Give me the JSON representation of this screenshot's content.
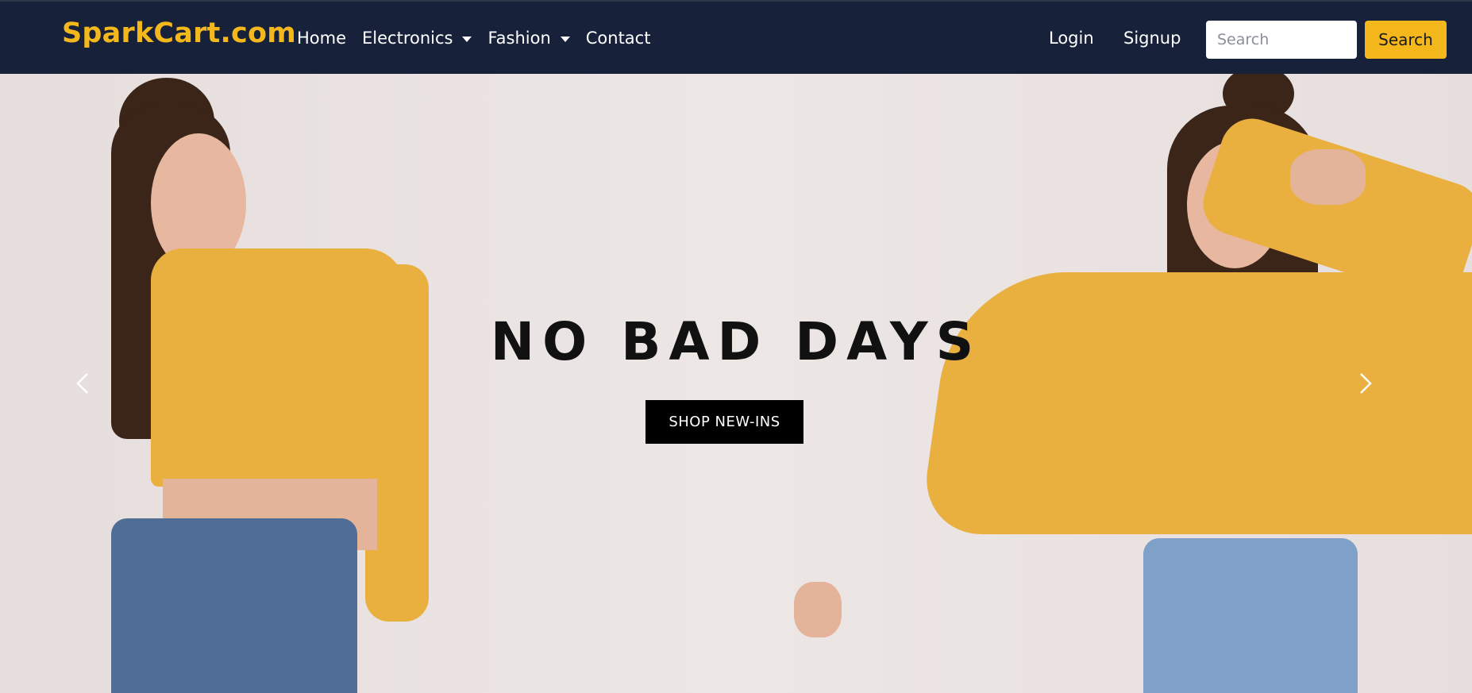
{
  "navbar": {
    "brand": "SparkCart.com",
    "links": [
      {
        "label": "Home",
        "dropdown": false
      },
      {
        "label": "Electronics",
        "dropdown": true
      },
      {
        "label": "Fashion",
        "dropdown": true
      },
      {
        "label": "Contact",
        "dropdown": false
      }
    ],
    "login": "Login",
    "signup": "Signup",
    "search_placeholder": "Search",
    "search_button": "Search"
  },
  "hero": {
    "headline": "NO BAD DAYS",
    "cta": "SHOP NEW-INS",
    "prev_icon": "chevron-left-icon",
    "next_icon": "chevron-right-icon"
  },
  "colors": {
    "navbar_bg": "#17223a",
    "accent": "#f5b81c",
    "hero_bg": "#e9e1e0"
  }
}
